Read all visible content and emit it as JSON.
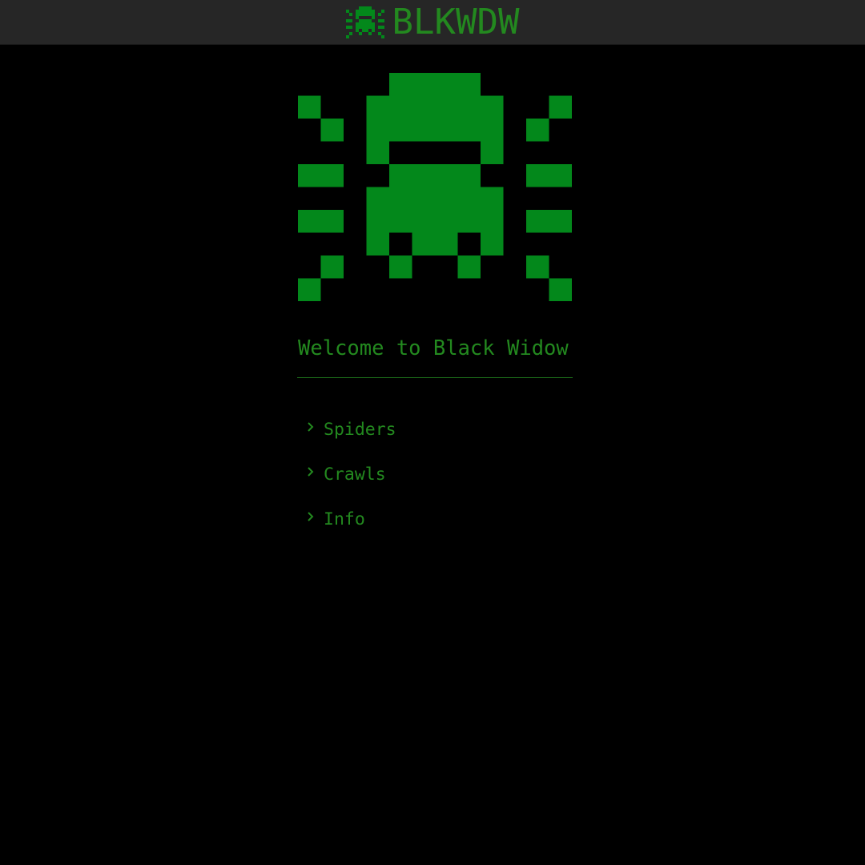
{
  "header": {
    "brand_icon": "spider-icon",
    "brand_name": "BLKWDW"
  },
  "hero": {
    "icon": "spider-icon",
    "welcome": "Welcome to Black Widow"
  },
  "menu": {
    "items": [
      {
        "label": "Spiders",
        "icon": "chevron-right-icon"
      },
      {
        "label": "Crawls",
        "icon": "chevron-right-icon"
      },
      {
        "label": "Info",
        "icon": "chevron-right-icon"
      }
    ]
  },
  "colors": {
    "background": "#000000",
    "topbar": "#262626",
    "accent": "#23891f",
    "logo": "#03881b"
  }
}
